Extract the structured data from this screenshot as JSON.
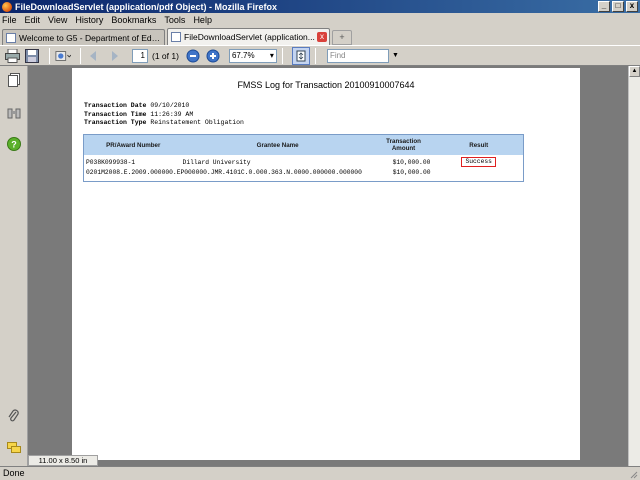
{
  "window": {
    "title": "FileDownloadServlet (application/pdf Object) - Mozilla Firefox",
    "minimize": "_",
    "maximize": "□",
    "close": "x"
  },
  "menu": [
    "File",
    "Edit",
    "View",
    "History",
    "Bookmarks",
    "Tools",
    "Help"
  ],
  "tabs": [
    {
      "label": "Welcome to G5 - Department of Educat..."
    },
    {
      "label": "FileDownloadServlet (application..."
    }
  ],
  "tab_close": "x",
  "new_tab": "+",
  "toolbar": {
    "page_number": "1",
    "page_of": "(1 of 1)",
    "zoom": "67.7%",
    "find_placeholder": "Find"
  },
  "document": {
    "title": "FMSS Log for Transaction 20100910007644",
    "meta": [
      {
        "label": "Transaction Date",
        "value": "09/10/2010"
      },
      {
        "label": "Transaction Time",
        "value": "11:26:39 AM"
      },
      {
        "label": "Transaction Type",
        "value": "Reinstatement Obligation"
      }
    ],
    "table": {
      "headers": [
        "PR/Award Number",
        "Grantee Name",
        "Transaction\nAmount",
        "Result"
      ],
      "rows": [
        {
          "award": "P038K099938-1",
          "grantee": "Dillard University",
          "amount": "$10,000.00",
          "result": "Success"
        },
        {
          "award": "0201M2008.E.2009.000000.EP000000.JMR.4101C.0.000.363.N.0000.000000.000000",
          "grantee": "",
          "amount": "$10,000.00",
          "result": ""
        }
      ]
    }
  },
  "page_size": "11.00 x 8.50 in",
  "status": "Done",
  "colors": {
    "table_header_bg": "#b8d4f0",
    "table_border": "#7a9cc8",
    "success_outline": "#e02020"
  }
}
